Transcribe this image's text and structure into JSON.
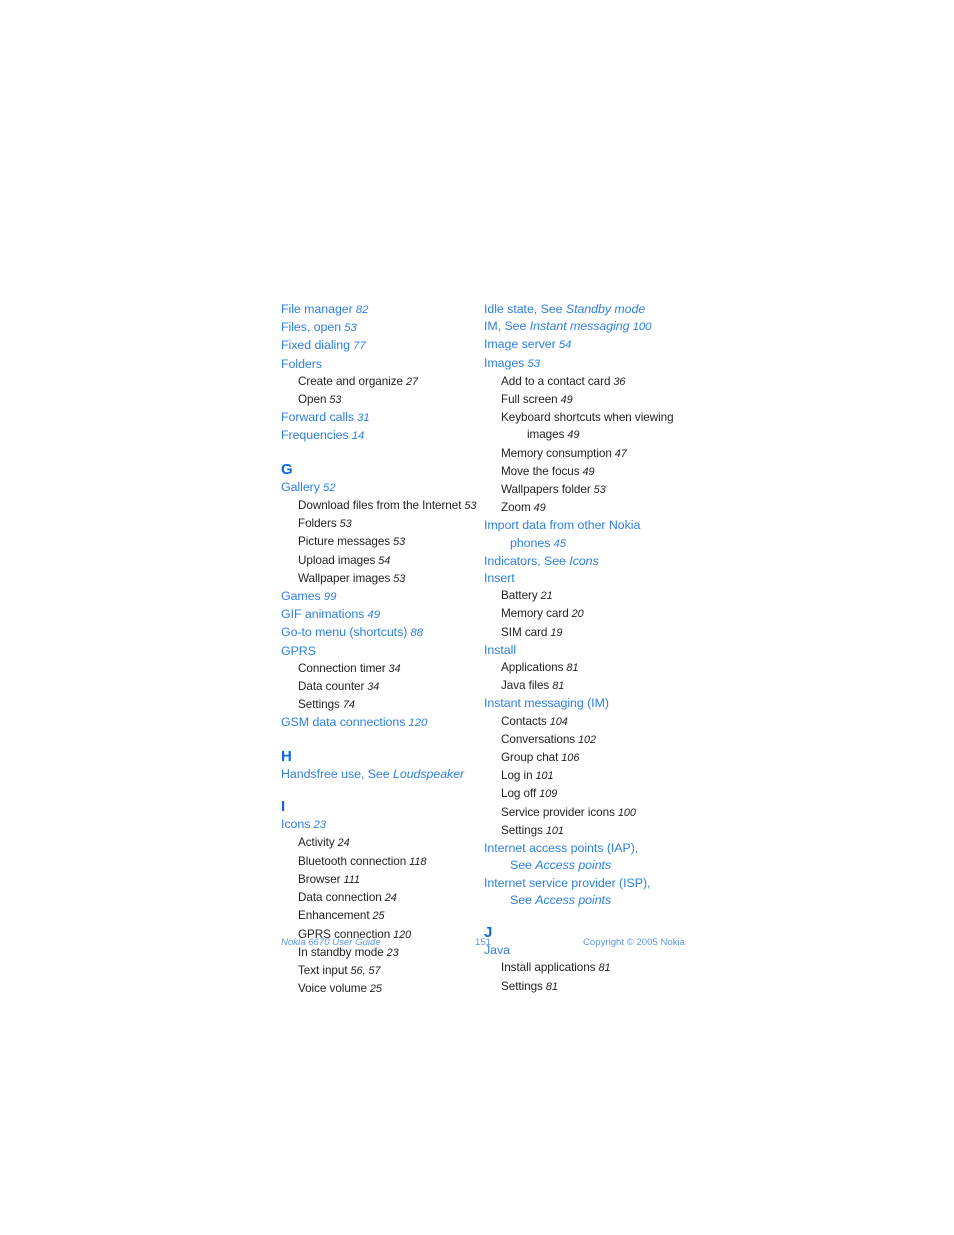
{
  "document": {
    "type": "index-page",
    "page_number": "151"
  },
  "footer": {
    "left": "Nokia 6670 User Guide",
    "center": "151",
    "right": "Copyright © 2005 Nokia"
  },
  "colors": {
    "entry_blue": "#2e80e0",
    "letter_blue": "#0a6ae4",
    "subentry_black": "#231f20",
    "footer_blue": "#5d95e8",
    "page_background": "#ffffff"
  },
  "left_column": [
    {
      "kind": "entry",
      "text": "File manager",
      "page": "82"
    },
    {
      "kind": "entry",
      "text": "Files, open",
      "page": "53"
    },
    {
      "kind": "entry",
      "text": "Fixed dialing",
      "page": "77"
    },
    {
      "kind": "entry",
      "text": "Folders",
      "page": ""
    },
    {
      "kind": "subentry",
      "text": "Create and organize",
      "page": "27"
    },
    {
      "kind": "subentry",
      "text": "Open",
      "page": "53"
    },
    {
      "kind": "entry",
      "text": "Forward calls",
      "page": "31"
    },
    {
      "kind": "entry",
      "text": "Frequencies",
      "page": "14"
    },
    {
      "kind": "letter",
      "text": "G"
    },
    {
      "kind": "entry",
      "text": "Gallery",
      "page": "52"
    },
    {
      "kind": "subentry",
      "text": "Download files from the Internet",
      "page": "53"
    },
    {
      "kind": "subentry",
      "text": "Folders",
      "page": "53"
    },
    {
      "kind": "subentry",
      "text": "Picture messages",
      "page": "53"
    },
    {
      "kind": "subentry",
      "text": "Upload images",
      "page": "54"
    },
    {
      "kind": "subentry",
      "text": "Wallpaper images",
      "page": "53"
    },
    {
      "kind": "entry",
      "text": "Games",
      "page": "99"
    },
    {
      "kind": "entry",
      "text": "GIF animations",
      "page": "49"
    },
    {
      "kind": "entry",
      "text": "Go-to menu (shortcuts)",
      "page": "88"
    },
    {
      "kind": "entry",
      "text": "GPRS",
      "page": ""
    },
    {
      "kind": "subentry",
      "text": "Connection timer",
      "page": "34"
    },
    {
      "kind": "subentry",
      "text": "Data counter",
      "page": "34"
    },
    {
      "kind": "subentry",
      "text": "Settings",
      "page": "74"
    },
    {
      "kind": "entry",
      "text": "GSM data connections",
      "page": "120"
    },
    {
      "kind": "letter",
      "text": "H"
    },
    {
      "kind": "entry",
      "text": "Handsfree use, See ",
      "italic": "Loudspeaker",
      "page": ""
    },
    {
      "kind": "letter",
      "text": "I"
    },
    {
      "kind": "entry",
      "text": "Icons",
      "page": "23"
    },
    {
      "kind": "subentry",
      "text": "Activity",
      "page": "24"
    },
    {
      "kind": "subentry",
      "text": "Bluetooth connection",
      "page": "118"
    },
    {
      "kind": "subentry",
      "text": "Browser",
      "page": "111"
    },
    {
      "kind": "subentry",
      "text": "Data connection",
      "page": "24"
    },
    {
      "kind": "subentry",
      "text": "Enhancement",
      "page": "25"
    },
    {
      "kind": "subentry",
      "text": "GPRS connection",
      "page": "120"
    },
    {
      "kind": "subentry",
      "text": "In standby mode",
      "page": "23"
    },
    {
      "kind": "subentry",
      "text": "Text input",
      "page": "56, 57"
    },
    {
      "kind": "subentry",
      "text": "Voice volume",
      "page": "25"
    }
  ],
  "right_column": [
    {
      "kind": "entry",
      "text": "Idle state, See ",
      "italic": "Standby mode",
      "page": ""
    },
    {
      "kind": "entry",
      "text": "IM, See ",
      "italic": "Instant messaging",
      "page": "100"
    },
    {
      "kind": "entry",
      "text": "Image server",
      "page": "54"
    },
    {
      "kind": "entry",
      "text": "Images",
      "page": "53"
    },
    {
      "kind": "subentry",
      "text": "Add to a contact card",
      "page": "36"
    },
    {
      "kind": "subentry",
      "text": "Full screen",
      "page": "49"
    },
    {
      "kind": "subentry",
      "text": "Keyboard shortcuts when viewing",
      "page": ""
    },
    {
      "kind": "subcont",
      "text": "images",
      "page": "49"
    },
    {
      "kind": "subentry",
      "text": "Memory consumption",
      "page": "47"
    },
    {
      "kind": "subentry",
      "text": "Move the focus",
      "page": "49"
    },
    {
      "kind": "subentry",
      "text": "Wallpapers folder",
      "page": "53"
    },
    {
      "kind": "subentry",
      "text": "Zoom",
      "page": "49"
    },
    {
      "kind": "entry",
      "text": "Import data from other Nokia",
      "page": ""
    },
    {
      "kind": "cont",
      "text": "phones",
      "page": "45"
    },
    {
      "kind": "entry",
      "text": "Indicators, See ",
      "italic": "Icons",
      "page": ""
    },
    {
      "kind": "entry",
      "text": "Insert",
      "page": ""
    },
    {
      "kind": "subentry",
      "text": "Battery",
      "page": "21"
    },
    {
      "kind": "subentry",
      "text": "Memory card",
      "page": "20"
    },
    {
      "kind": "subentry",
      "text": "SIM card",
      "page": "19"
    },
    {
      "kind": "entry",
      "text": "Install",
      "page": ""
    },
    {
      "kind": "subentry",
      "text": "Applications",
      "page": "81"
    },
    {
      "kind": "subentry",
      "text": "Java files",
      "page": "81"
    },
    {
      "kind": "entry",
      "text": "Instant messaging (IM)",
      "page": ""
    },
    {
      "kind": "subentry",
      "text": "Contacts",
      "page": "104"
    },
    {
      "kind": "subentry",
      "text": "Conversations",
      "page": "102"
    },
    {
      "kind": "subentry",
      "text": "Group chat",
      "page": "106"
    },
    {
      "kind": "subentry",
      "text": "Log in",
      "page": "101"
    },
    {
      "kind": "subentry",
      "text": "Log off",
      "page": "109"
    },
    {
      "kind": "subentry",
      "text": "Service provider icons",
      "page": "100"
    },
    {
      "kind": "subentry",
      "text": "Settings",
      "page": "101"
    },
    {
      "kind": "entry",
      "text": "Internet access points (IAP),",
      "page": ""
    },
    {
      "kind": "cont",
      "text": "See ",
      "italic": "Access points",
      "page": ""
    },
    {
      "kind": "entry",
      "text": "Internet service provider (ISP),",
      "page": ""
    },
    {
      "kind": "cont",
      "text": "See ",
      "italic": "Access points",
      "page": ""
    },
    {
      "kind": "letter",
      "text": "J"
    },
    {
      "kind": "entry",
      "text": "Java",
      "page": ""
    },
    {
      "kind": "subentry",
      "text": "Install applications",
      "page": "81"
    },
    {
      "kind": "subentry",
      "text": "Settings",
      "page": "81"
    }
  ]
}
